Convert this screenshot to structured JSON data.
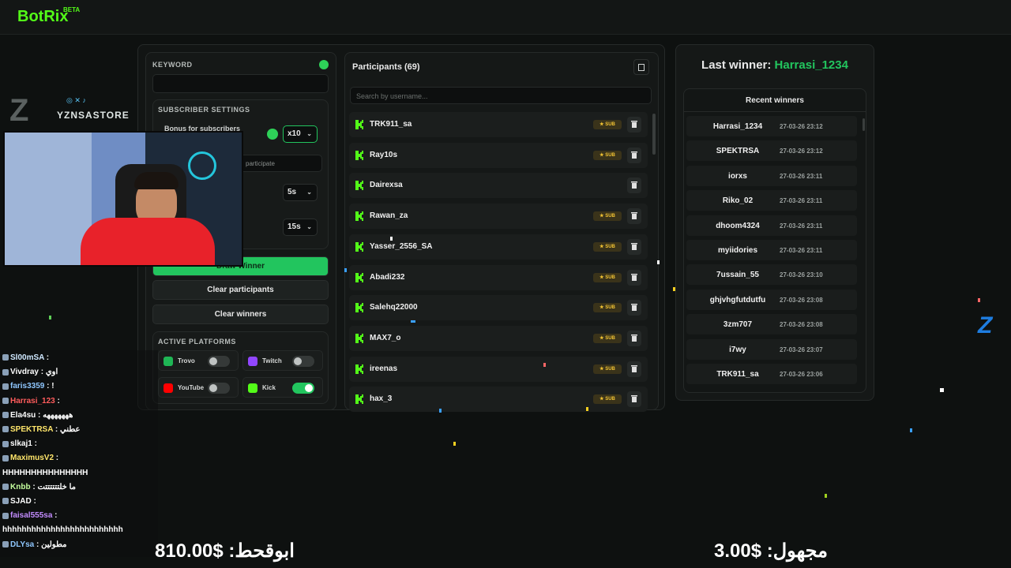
{
  "app": {
    "name": "BotRix",
    "badge": "BETA"
  },
  "settings": {
    "keyword_label": "KEYWORD",
    "keyword_value": "",
    "subscriber_settings_label": "SUBSCRIBER SETTINGS",
    "bonus_label": "Bonus for subscribers",
    "bonus_value": "x10",
    "participate_text": "participate",
    "timer_value_1": "5s",
    "timer_value_2": "15s",
    "draw_winner": "Draw Winner",
    "clear_participants": "Clear participants",
    "clear_winners": "Clear winners",
    "active_platforms_label": "ACTIVE PLATFORMS",
    "platforms": [
      {
        "name": "Trovo",
        "enabled": false,
        "color": "#1fb655"
      },
      {
        "name": "Twitch",
        "enabled": false,
        "color": "#9146ff"
      },
      {
        "name": "YouTube",
        "enabled": false,
        "color": "#ff0000"
      },
      {
        "name": "Kick",
        "enabled": true,
        "color": "#53fc18"
      }
    ]
  },
  "participants": {
    "title": "Participants (69)",
    "search_placeholder": "Search by username...",
    "sub_label": "SUB",
    "items": [
      {
        "name": "TRK911_sa",
        "sub": true
      },
      {
        "name": "Ray10s",
        "sub": true
      },
      {
        "name": "Dairexsa",
        "sub": false
      },
      {
        "name": "Rawan_za",
        "sub": true
      },
      {
        "name": "Yasser_2556_SA",
        "sub": true
      },
      {
        "name": "Abadi232",
        "sub": true
      },
      {
        "name": "Salehq22000",
        "sub": true
      },
      {
        "name": "MAX7_o",
        "sub": true
      },
      {
        "name": "ireenas",
        "sub": true
      },
      {
        "name": "hax_3",
        "sub": true
      }
    ]
  },
  "winners": {
    "last_winner_prefix": "Last winner: ",
    "last_winner_name": "Harrasi_1234",
    "recent_title": "Recent winners",
    "items": [
      {
        "name": "Harrasi_1234",
        "date": "27-03-26 23:12"
      },
      {
        "name": "SPEKTRSA",
        "date": "27-03-26 23:12"
      },
      {
        "name": "iorxs",
        "date": "27-03-26 23:11"
      },
      {
        "name": "Riko_02",
        "date": "27-03-26 23:11"
      },
      {
        "name": "dhoom4324",
        "date": "27-03-26 23:11"
      },
      {
        "name": "myiidories",
        "date": "27-03-26 23:11"
      },
      {
        "name": "7ussain_55",
        "date": "27-03-26 23:10"
      },
      {
        "name": "ghjvhgfutdutfu",
        "date": "27-03-26 23:08"
      },
      {
        "name": "3zm707",
        "date": "27-03-26 23:08"
      },
      {
        "name": "i7wy",
        "date": "27-03-26 23:07"
      },
      {
        "name": "TRK911_sa",
        "date": "27-03-26 23:06"
      }
    ]
  },
  "overlay": {
    "brand": "YZNSASTORE",
    "chat": [
      {
        "user": "Sl00mSA",
        "msg": "",
        "color": "#cfe8ff"
      },
      {
        "user": "Vivdray",
        "msg": "اوي",
        "color": "#ffffff"
      },
      {
        "user": "faris3359",
        "msg": "!",
        "color": "#8fc7ff"
      },
      {
        "user": "Harrasi_123",
        "msg": "",
        "color": "#ff5c5c"
      },
      {
        "user": "Ela4su",
        "msg": "هههههههه",
        "color": "#ffffff"
      },
      {
        "user": "SPEKTRSA",
        "msg": "عطني",
        "color": "#ffe66b"
      },
      {
        "user": "slkaj1",
        "msg": "",
        "color": "#ffffff"
      },
      {
        "user": "MaximusV2",
        "msg": "",
        "color": "#ffe66b"
      },
      {
        "user": "",
        "msg": "HHHHHHHHHHHHHHH",
        "color": "#ffffff"
      },
      {
        "user": "Knbb",
        "msg": "ما خلتتتتتتت",
        "color": "#c5ff9e"
      },
      {
        "user": "SJAD",
        "msg": "",
        "color": "#ffffff"
      },
      {
        "user": "faisal555sa",
        "msg": "",
        "color": "#c38cff"
      },
      {
        "user": "",
        "msg": "hhhhhhhhhhhhhhhhhhhhhhhhh",
        "color": "#ffffff"
      },
      {
        "user": "DLYsa",
        "msg": "مطولين",
        "color": "#8fc7ff"
      }
    ],
    "donation_left": "ابوقحط: $810.00",
    "donation_right": "مجهول: $3.00"
  }
}
